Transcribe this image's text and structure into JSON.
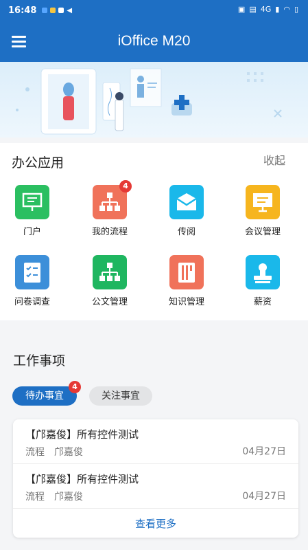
{
  "status": {
    "time": "16:48",
    "network": "4G"
  },
  "appbar": {
    "title": "iOffice M20"
  },
  "office_apps": {
    "title": "办公应用",
    "collapse_label": "收起",
    "items": [
      {
        "label": "门户",
        "icon": "presentation-board-icon",
        "color": "#2bbf61",
        "badge": ""
      },
      {
        "label": "我的流程",
        "icon": "org-flow-icon",
        "color": "#f0725a",
        "badge": "4"
      },
      {
        "label": "传阅",
        "icon": "envelope-icon",
        "color": "#1ab8ea",
        "badge": ""
      },
      {
        "label": "会议管理",
        "icon": "meeting-board-icon",
        "color": "#f6b51e",
        "badge": ""
      },
      {
        "label": "问卷调查",
        "icon": "checklist-icon",
        "color": "#3c8fd9",
        "badge": ""
      },
      {
        "label": "公文管理",
        "icon": "hierarchy-icon",
        "color": "#1fb660",
        "badge": ""
      },
      {
        "label": "知识管理",
        "icon": "book-icon",
        "color": "#f0725a",
        "badge": ""
      },
      {
        "label": "薪资",
        "icon": "stamp-icon",
        "color": "#1ab8ea",
        "badge": ""
      }
    ]
  },
  "work": {
    "title": "工作事项",
    "tabs": [
      {
        "label": "待办事宜",
        "badge": "4"
      },
      {
        "label": "关注事宜"
      }
    ],
    "items": [
      {
        "title": "【邝嘉俊】所有控件测试",
        "meta": "流程　邝嘉俊",
        "date": "04月27日"
      },
      {
        "title": "【邝嘉俊】所有控件测试",
        "meta": "流程　邝嘉俊",
        "date": "04月27日"
      }
    ],
    "more_label": "查看更多"
  },
  "colors": {
    "primary": "#1e6fc4",
    "badge": "#e53935"
  }
}
